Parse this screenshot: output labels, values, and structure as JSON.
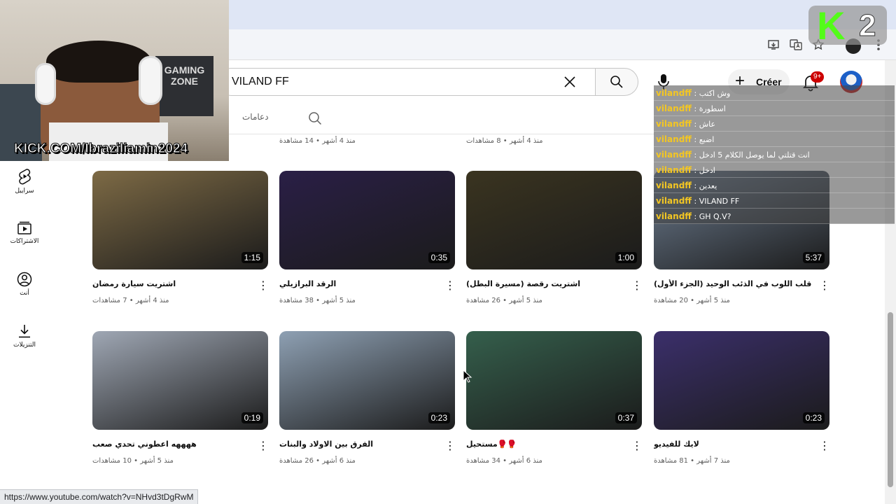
{
  "search": {
    "query": "VILAND FF"
  },
  "header": {
    "create_label": "Créer",
    "notifications_badge": "9+"
  },
  "channel_tabs": {
    "tab_label": "دعامات"
  },
  "sidebar": {
    "items": [
      {
        "label": "سرايبل",
        "icon": "shorts-icon"
      },
      {
        "label": "الاشتراكات",
        "icon": "subscriptions-icon"
      },
      {
        "label": "أنت",
        "icon": "account-icon"
      },
      {
        "label": "التنزيلات",
        "icon": "download-icon"
      }
    ]
  },
  "previous_row_meta": [
    "منذ 4 أشهر • 14 مشاهدة",
    "منذ 4 أشهر • 8 مشاهدات"
  ],
  "videos": [
    {
      "title": "اشتريت سيارة رمضان",
      "meta": "منذ 4 أشهر • 7 مشاهدات",
      "duration": "1:15"
    },
    {
      "title": "الرقد البرازيلي",
      "meta": "منذ 5 أشهر • 38 مشاهدة",
      "duration": "0:35"
    },
    {
      "title": "اشتريت رقصة (مسيرة البطل)",
      "meta": "منذ 5 أشهر • 26 مشاهدة",
      "duration": "1:00"
    },
    {
      "title": "قلب اللوب في الذئب الوحيد (الجزء الأول)",
      "meta": "منذ 5 أشهر • 20 مشاهدة",
      "duration": "5:37"
    },
    {
      "title": "ههههه اعطوني تحدي صعب",
      "meta": "منذ 5 أشهر • 10 مشاهدات",
      "duration": "0:19"
    },
    {
      "title": "الفرق بين الاولاد والبنات",
      "meta": "منذ 6 أشهر • 26 مشاهدة",
      "duration": "0:23"
    },
    {
      "title": "🥊🥊مستحيل",
      "meta": "منذ 6 أشهر • 34 مشاهدة",
      "duration": "0:37"
    },
    {
      "title": "لايك للفيديو",
      "meta": "منذ 7 أشهر • 81 مشاهدة",
      "duration": "0:23"
    }
  ],
  "thumb_colors": [
    "#7d6a45",
    "#2a1f46",
    "#3a3420",
    "#6f7f93",
    "#9fa7b4",
    "#8ea0b3",
    "#355f4c",
    "#3b2f6b"
  ],
  "status_url": "https://www.youtube.com/watch?v=NHvd3tDgRwM",
  "stream": {
    "kick_url": "KICK.COM/Ibraziliamin2024",
    "kick_logo_letter": "K",
    "kick_logo_number": "2",
    "gaming_zone": "GAMING ZONE"
  },
  "chat": {
    "separator": " : ",
    "messages": [
      {
        "user": "vilandff",
        "text": "وش اكتب"
      },
      {
        "user": "vilandff",
        "text": "اسطورة"
      },
      {
        "user": "vilandff",
        "text": "عاش"
      },
      {
        "user": "vilandff",
        "text": "اضبع"
      },
      {
        "user": "vilandff",
        "text": "انت قتلتي لما يوصل الكلام 5 ادخل"
      },
      {
        "user": "vilandff",
        "text": "ادخل"
      },
      {
        "user": "vilandff",
        "text": "يعدين"
      },
      {
        "user": "vilandff",
        "text": "VILAND FF"
      },
      {
        "user": "vilandff",
        "text": "GH Q.V?"
      }
    ]
  },
  "colors": {
    "kick_green": "#53fc18",
    "chat_user": "#f3c623",
    "badge_red": "#cc0000"
  }
}
